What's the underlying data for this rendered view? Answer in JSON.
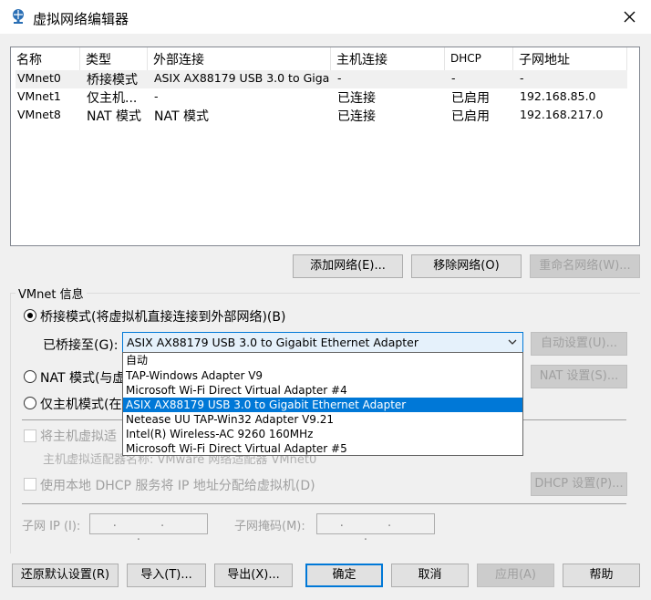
{
  "window": {
    "title": "虚拟网络编辑器",
    "close_glyph": "✕"
  },
  "network_list": {
    "columns": [
      "名称",
      "类型",
      "外部连接",
      "主机连接",
      "DHCP",
      "子网地址"
    ],
    "rows": [
      [
        "VMnet0",
        "桥接模式",
        "ASIX AX88179 USB 3.0 to Giga...",
        "-",
        "-",
        "-"
      ],
      [
        "VMnet1",
        "仅主机...",
        "-",
        "已连接",
        "已启用",
        "192.168.85.0"
      ],
      [
        "VMnet8",
        "NAT 模式",
        "NAT 模式",
        "已连接",
        "已启用",
        "192.168.217.0"
      ]
    ],
    "selected_row": 0
  },
  "list_buttons": {
    "add": "添加网络(E)...",
    "remove": "移除网络(O)",
    "rename": "重命名网络(W)..."
  },
  "vmnet_info": {
    "legend": "VMnet 信息",
    "bridge_label": "桥接模式(将虚拟机直接连接到外部网络)(B)",
    "bridged_to_label": "已桥接至(G):",
    "bridged_to_value": "ASIX AX88179 USB 3.0 to Gigabit Ethernet Adapter",
    "auto_settings": "自动设置(U)...",
    "nat_label": "NAT 模式(与虚",
    "nat_settings": "NAT 设置(S)...",
    "hostonly_label": "仅主机模式(在",
    "connect_host_label": "将主机虚拟适",
    "host_adapter_name": "主机虚拟适配器名称: VMware 网络适配器 VMnet0",
    "dhcp_label": "使用本地 DHCP 服务将 IP 地址分配给虚拟机(D)",
    "dhcp_settings": "DHCP 设置(P)...",
    "subnet_ip_label": "子网 IP (I):",
    "subnet_mask_label": "子网掩码(M):",
    "ip_placeholder": ". . ."
  },
  "dropdown": {
    "options": [
      "自动",
      "TAP-Windows Adapter V9",
      "Microsoft Wi-Fi Direct Virtual Adapter #4",
      "ASIX AX88179 USB 3.0 to Gigabit Ethernet Adapter",
      "Netease UU TAP-Win32 Adapter V9.21",
      "Intel(R) Wireless-AC 9260 160MHz",
      "Microsoft Wi-Fi Direct Virtual Adapter #5"
    ],
    "selected_index": 3
  },
  "footer": {
    "restore": "还原默认设置(R)",
    "import": "导入(T)...",
    "export": "导出(X)...",
    "ok": "确定",
    "cancel": "取消",
    "apply": "应用(A)",
    "help": "帮助"
  },
  "colors": {
    "accent": "#0078d7",
    "window_bg": "#f0f0f0",
    "disabled_text": "#a0a0a0"
  }
}
